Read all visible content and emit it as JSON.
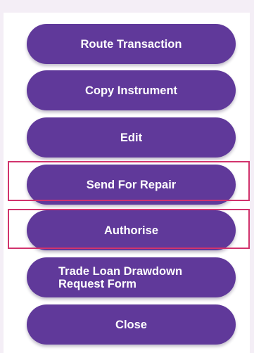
{
  "actions": {
    "route_transaction": "Route Transaction",
    "copy_instrument": "Copy Instrument",
    "edit": "Edit",
    "send_for_repair": "Send For Repair",
    "authorise": "Authorise",
    "trade_loan_line1": "Trade Loan Drawdown",
    "trade_loan_line2": "Request Form",
    "close": "Close"
  },
  "colors": {
    "button_bg": "#60399a",
    "button_text": "#ffffff",
    "highlight_border": "#d1336d",
    "page_bg": "#f4eef6"
  }
}
